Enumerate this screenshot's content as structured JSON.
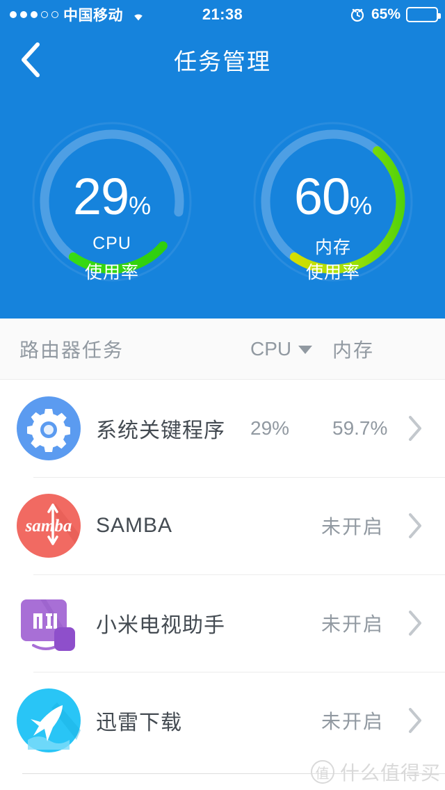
{
  "statusbar": {
    "signal_dots_filled": 3,
    "signal_dots_total": 5,
    "carrier": "中国移动",
    "wifi_icon": "wifi-icon",
    "time": "21:38",
    "alarm_icon": "alarm-clock-icon",
    "battery_percent": "65%",
    "battery_level": 65,
    "battery_color": "#FFCC00"
  },
  "navbar": {
    "back_icon": "chevron-left-icon",
    "title": "任务管理"
  },
  "gauges": [
    {
      "value_number": "29",
      "value_percent": "%",
      "name": "CPU",
      "sub": "使用率",
      "percent": 29,
      "arc_start_color": "#2ECC0C",
      "arc_end_color": "#2ECC0C"
    },
    {
      "value_number": "60",
      "value_percent": "%",
      "name": "内存",
      "sub": "使用率",
      "percent": 60,
      "arc_start_color": "#2ECC0C",
      "arc_end_color": "#F5DD00"
    }
  ],
  "list_header": {
    "title": "路由器任务",
    "cpu_label": "CPU",
    "sort_icon": "caret-down-icon",
    "mem_label": "内存"
  },
  "tasks": [
    {
      "icon": "gear-icon",
      "name": "系统关键程序",
      "cpu": "29%",
      "mem": "59.7%",
      "status": "",
      "chevron": "chevron-right-icon"
    },
    {
      "icon": "samba-icon",
      "name": "SAMBA",
      "cpu": "",
      "mem": "",
      "status": "未开启",
      "chevron": "chevron-right-icon"
    },
    {
      "icon": "xiaomi-tv-icon",
      "name": "小米电视助手",
      "cpu": "",
      "mem": "",
      "status": "未开启",
      "chevron": "chevron-right-icon"
    },
    {
      "icon": "thunder-icon",
      "name": "迅雷下载",
      "cpu": "",
      "mem": "",
      "status": "未开启",
      "chevron": "chevron-right-icon"
    }
  ],
  "watermark": {
    "badge": "值",
    "text": "什么值得买"
  },
  "colors": {
    "header_blue": "#1683DC",
    "track_blue": "#4E9FE4",
    "green": "#2ECC0C",
    "yellow": "#F5DD00",
    "text_gray": "#9199a1",
    "text_dark": "#444b52"
  }
}
